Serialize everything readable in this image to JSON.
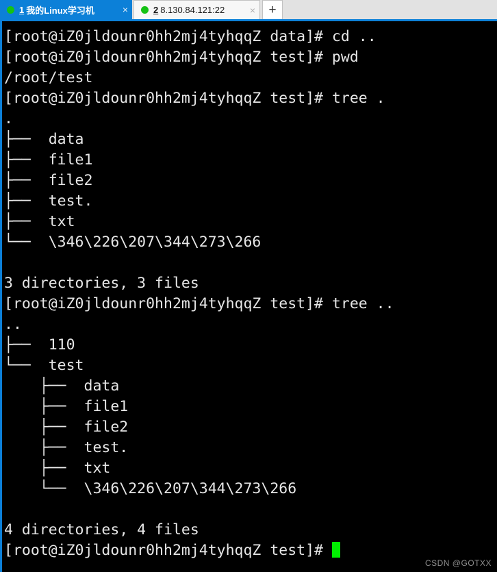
{
  "window": {
    "tabs": [
      {
        "number": "1",
        "label": "我的Linux学习机",
        "close_label": "×",
        "status_icon": "connected-dot-icon",
        "active": true
      },
      {
        "number": "2",
        "label": "8.130.84.121:22",
        "close_label": "×",
        "status_icon": "connected-dot-icon",
        "active": false
      }
    ],
    "new_tab_label": "+",
    "accent_color": "#0c80d8",
    "tabstrip_bg": "#e2e2e2",
    "connected_dot_color": "#15c215"
  },
  "terminal": {
    "background_color": "#000000",
    "text_color": "#e6e6e6",
    "cursor_color": "#00ef00",
    "prompt_user": "root",
    "prompt_host": "iZ0jldounr0hh2mj4tyhqqZ",
    "lines": [
      "[root@iZ0jldounr0hh2mj4tyhqqZ data]# cd ..",
      "[root@iZ0jldounr0hh2mj4tyhqqZ test]# pwd",
      "/root/test",
      "[root@iZ0jldounr0hh2mj4tyhqqZ test]# tree .",
      ".",
      "├──  data",
      "├──  file1",
      "├──  file2",
      "├──  test.",
      "├──  txt",
      "└──  \\346\\226\\207\\344\\273\\266",
      "",
      "3 directories, 3 files",
      "[root@iZ0jldounr0hh2mj4tyhqqZ test]# tree ..",
      "..",
      "├──  110",
      "└──  test",
      "    ├──  data",
      "    ├──  file1",
      "    ├──  file2",
      "    ├──  test.",
      "    ├──  txt",
      "    └──  \\346\\226\\207\\344\\273\\266",
      "",
      "4 directories, 4 files"
    ],
    "prompt_line": "[root@iZ0jldounr0hh2mj4tyhqqZ test]# "
  },
  "watermark": {
    "text": "CSDN @GOTXX"
  }
}
